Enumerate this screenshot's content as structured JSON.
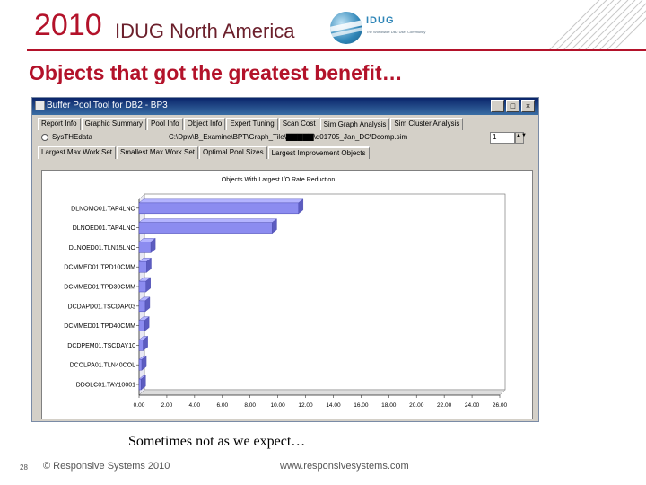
{
  "header": {
    "year": "2010",
    "conference": "IDUG North America",
    "logo_text": "IDUG",
    "logo_sub": "The Worldwide DB2 User Community"
  },
  "slide": {
    "title": "Objects that got the greatest benefit…",
    "caption": "Sometimes not as we expect…",
    "page_number": "28",
    "copyright": "© Responsive Systems 2010",
    "url": "www.responsivesystems.com"
  },
  "window": {
    "title": "Buffer Pool Tool for DB2 - BP3",
    "tabs": [
      "Report Info",
      "Graphic Summary",
      "Pool Info",
      "Object Info",
      "Expert Tuning",
      "Scan Cost",
      "Sim Graph Analysis",
      "Sim Cluster Analysis"
    ],
    "active_tab": 6,
    "radio_label": "SysTHEdata",
    "path_text": "C:\\Dpw\\B_Examine\\BPT\\Graph_Tile\\▇▇▇▇▇\\d01705_Jan_DC\\Dcomp.sim",
    "spin_value": "1",
    "subtabs": [
      "Largest Max Work Set",
      "Smallest Max Work Set",
      "Optimal Pool Sizes",
      "Largest Improvement Objects"
    ],
    "active_subtab": 3,
    "buttons": {
      "min": "_",
      "max": "□",
      "close": "×"
    }
  },
  "chart_data": {
    "type": "bar",
    "orientation": "horizontal",
    "title": "Objects With Largest I/O Rate Reduction",
    "categories": [
      "DLNOMO01.TAP4LNO",
      "DLNOED01.TAP4LNO",
      "DLNOED01.TLN15LNO",
      "DCMMED01.TPD10CMM",
      "DCMMED01.TPD30CMM",
      "DCDAPD01.TSCDAP03",
      "DCMMED01.TPD40CMM",
      "DCDPEM01.TSCDAY10",
      "DCOLPA01.TLN40COL",
      "DDOLC01.TAY10001"
    ],
    "values": [
      11.5,
      9.6,
      0.85,
      0.55,
      0.5,
      0.45,
      0.4,
      0.3,
      0.2,
      0.15
    ],
    "x_ticks": [
      "0.00",
      "2.00",
      "4.00",
      "6.00",
      "8.00",
      "10.00",
      "12.00",
      "14.00",
      "16.00",
      "18.00",
      "20.00",
      "22.00",
      "24.00",
      "26.00"
    ],
    "xlim": [
      0,
      26
    ],
    "grid": false,
    "bar_color": "#8c8cf0",
    "bar_top_color": "#b4b4ff",
    "bar_side_color": "#5c5cc0"
  },
  "colors": {
    "brand_red": "#b3122a",
    "window_titlebar": "#0a246a"
  }
}
